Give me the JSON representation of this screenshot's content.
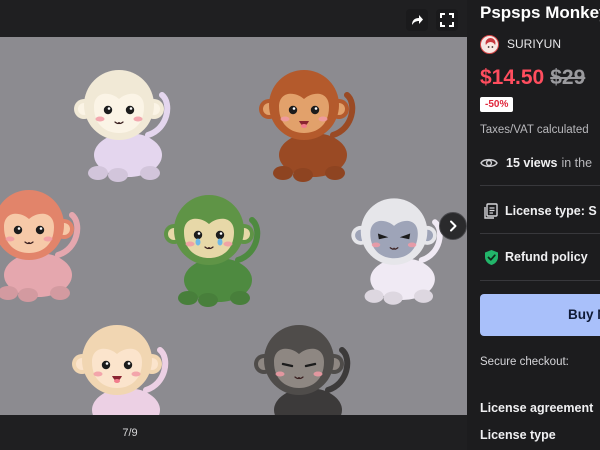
{
  "gallery": {
    "counter": "7/9"
  },
  "product": {
    "title": "Pspsps Monkey",
    "author": "SURIYUN",
    "price": "$14.50",
    "original_price": "$29",
    "discount": "-50%",
    "taxes_note": "Taxes/VAT calculated",
    "views_count": "15 views",
    "views_suffix": "in the",
    "license_label": "License type: S",
    "refund_label": "Refund policy",
    "buy_label": "Buy N",
    "secure_checkout": "Secure checkout:",
    "license_agreement": "License agreement",
    "license_type_link": "License type"
  },
  "colors": {
    "accent_price": "#ff4d5e",
    "buy_button": "#a9c0fa",
    "refund_shield": "#22b56a",
    "viewer_background": "#8c8b90"
  },
  "monkeys": [
    {
      "name": "cream-monkey",
      "fur": "#f1e9d6",
      "face": "#fbf4e6",
      "body": "#e4d6ee",
      "mood": "happy"
    },
    {
      "name": "brown-monkey",
      "fur": "#b45a2c",
      "face": "#e2a16b",
      "body": "#9a4a24",
      "mood": "open-mouth"
    },
    {
      "name": "salmon-monkey",
      "fur": "#e2846a",
      "face": "#f6c9a8",
      "body": "#e5a7ae",
      "mood": "cute"
    },
    {
      "name": "green-monkey",
      "fur": "#5f9446",
      "face": "#e7d8a8",
      "body": "#4e8a40",
      "mood": "crying"
    },
    {
      "name": "gray-monkey",
      "fur": "#e6e6ea",
      "face": "#9ea4b8",
      "body": "#f0eaf4",
      "mood": "angry"
    },
    {
      "name": "peach-monkey",
      "fur": "#f1d6b2",
      "face": "#fbe4cc",
      "body": "#ecd0e4",
      "mood": "tongue"
    },
    {
      "name": "dark-monkey",
      "fur": "#4f4c4a",
      "face": "#8e8782",
      "body": "#3c3a3a",
      "mood": "sleepy"
    }
  ]
}
